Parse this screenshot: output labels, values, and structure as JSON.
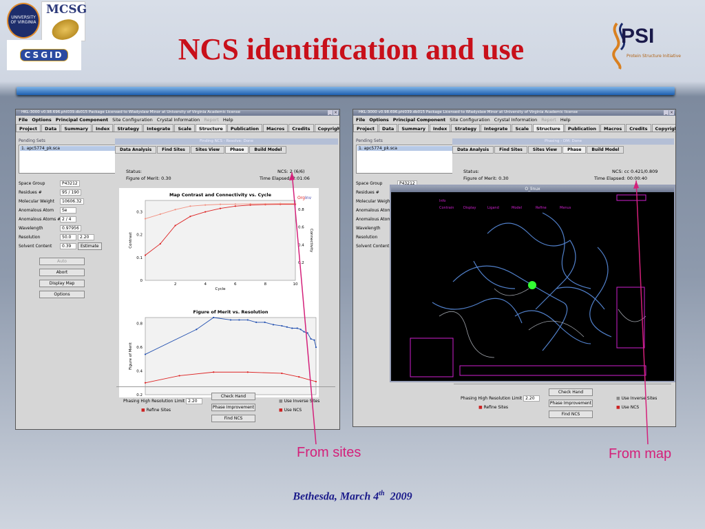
{
  "slide": {
    "title": "NCS identification and use",
    "footer_prefix": "Bethesda, March 4",
    "footer_sup": "th",
    "footer_year": "2009",
    "annot_left": "From sites",
    "annot_right": "From map"
  },
  "logos": {
    "uva": "UNIVERSITY OF VIRGINIA",
    "mcsg": "MCSG",
    "csgid": "CSGID",
    "psi": "PSI",
    "psi_sub": "Protein Structure Initiative"
  },
  "app": {
    "window_title": "HKL-3000 v0.98.696.phl039.db015       Package Licensed to Wladyslaw Minor at University of Virginia       Academic license",
    "menus": [
      "File",
      "Options",
      "Principal Component",
      "Site Configuration",
      "Crystal Information",
      "Report",
      "Help"
    ],
    "tabs": [
      "Project",
      "Data",
      "Summary",
      "Index",
      "Strategy",
      "Integrate",
      "Scale",
      "Structure",
      "Publication",
      "Macros",
      "Credits",
      "Copyrights"
    ],
    "pending_label": "Pending Sets",
    "pending_item": "1. apc5774_pk.sca",
    "fields": [
      {
        "l": "Space Group",
        "v": "P43212"
      },
      {
        "l": "Residues #",
        "v": "95 / 190"
      },
      {
        "l": "Molecular Weight",
        "v": "10606.32"
      },
      {
        "l": "Anomalous Atom",
        "v": "Se"
      },
      {
        "l": "Anomalous Atoms #",
        "v": "2 / 4"
      },
      {
        "l": "Wavelength",
        "v": "0.97956"
      }
    ],
    "resolution_label": "Resolution",
    "res_lo": "50.0",
    "res_hi": "2.20",
    "solvent_label": "Solvent Content",
    "solvent": "0.39",
    "estimate": "Estimate",
    "buttons": [
      "Auto",
      "Abort",
      "Display Map",
      "Options"
    ],
    "subtabs": [
      "Data Analysis",
      "Find Sites",
      "Sites View",
      "Phase",
      "Build Model"
    ],
    "bottom": {
      "phasing_label": "Phasing High Resolution Limit",
      "phasing_val": "2.20",
      "refine": "Refine Sites",
      "check": "Check Hand",
      "phase_imp": "Phase Improvement",
      "find_ncs": "Find NCS",
      "inverse": "Use Inverse Sites",
      "use_ncs": "Use NCS"
    }
  },
  "left_win": {
    "sub_title": "Finding NCS - Resolve: Done",
    "status_label": "Status:",
    "ncs_label": "NCS:",
    "ncs_val": "2 (6/6)",
    "fom_label": "Figure of Merit:",
    "fom_val": "0.30",
    "time_label": "Time Elapsed:",
    "time_val": "2:01:06",
    "chart1_title": "Map Contrast and Connectivity vs. Cycle",
    "chart1_org": "Org",
    "chart1_inv": "Inv",
    "chart2_title": "Figure of Merit vs. Resolution"
  },
  "right_win": {
    "sub_title": "Phasing - DM: Done",
    "ncs_val": "cc 0.421/0.809",
    "time_val": "00:00:40",
    "glx_title": "O_linux"
  },
  "chart_data": [
    {
      "type": "line",
      "title": "Map Contrast and Connectivity vs. Cycle",
      "xlabel": "Cycle",
      "ylabel": "Contrast",
      "y2label": "Connectivity",
      "xlim": [
        0,
        10
      ],
      "ylim": [
        0,
        0.35
      ],
      "y2lim": [
        0,
        0.9
      ],
      "xticks": [
        2,
        4,
        6,
        8,
        10
      ],
      "yticks": [
        0,
        0.1,
        0.2,
        0.3
      ],
      "y2ticks": [
        0.2,
        0.4,
        0.6,
        0.8
      ],
      "series": [
        {
          "color": "#d22",
          "x": [
            0,
            1,
            2,
            3,
            4,
            5,
            6,
            7,
            8,
            9,
            10
          ],
          "y": [
            0.11,
            0.16,
            0.24,
            0.28,
            0.3,
            0.315,
            0.325,
            0.33,
            0.332,
            0.333,
            0.333
          ]
        },
        {
          "color": "#f29080",
          "x": [
            0,
            1,
            2,
            3,
            4,
            5,
            6,
            7,
            8,
            9,
            10
          ],
          "y": [
            0.27,
            0.29,
            0.31,
            0.325,
            0.33,
            0.333,
            0.334,
            0.335,
            0.335,
            0.336,
            0.336
          ]
        }
      ]
    },
    {
      "type": "line",
      "title": "Figure of Merit vs. Resolution",
      "xlabel": "",
      "ylabel": "Figure of Merit",
      "ylim": [
        0.2,
        0.85
      ],
      "yticks": [
        0.2,
        0.4,
        0.6,
        0.8
      ],
      "xlim": [
        0,
        10
      ],
      "series": [
        {
          "color": "#2250b0",
          "x": [
            0,
            3,
            4,
            5,
            5.5,
            6,
            6.5,
            7,
            7.5,
            8,
            8.3,
            8.6,
            8.9,
            9.1,
            9.3,
            9.5,
            9.7,
            9.9,
            10
          ],
          "y": [
            0.54,
            0.75,
            0.85,
            0.83,
            0.83,
            0.83,
            0.81,
            0.81,
            0.79,
            0.78,
            0.77,
            0.76,
            0.76,
            0.75,
            0.73,
            0.72,
            0.67,
            0.66,
            0.6
          ]
        },
        {
          "color": "#d22",
          "x": [
            0,
            2,
            4,
            6,
            8,
            9,
            10
          ],
          "y": [
            0.3,
            0.36,
            0.39,
            0.39,
            0.38,
            0.35,
            0.31
          ]
        }
      ]
    }
  ]
}
